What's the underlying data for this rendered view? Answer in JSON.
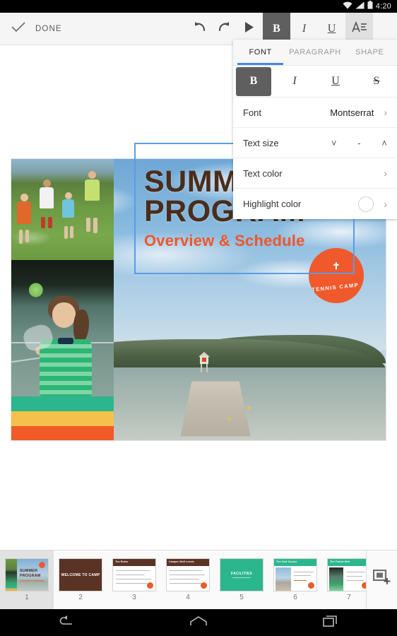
{
  "status_bar": {
    "time": "4:20",
    "icons": [
      "wifi-icon",
      "signal-icon",
      "battery-icon"
    ]
  },
  "toolbar": {
    "done_label": "DONE",
    "check_icon": "check-icon",
    "undo_icon": "undo-icon",
    "redo_icon": "redo-icon",
    "present_icon": "play-icon",
    "bold_label": "B",
    "italic_label": "I",
    "underline_label": "U",
    "text_format_label": "A",
    "overflow_icon": "overflow-menu-icon",
    "bold_active": true,
    "text_format_active": true
  },
  "font_panel": {
    "tabs": [
      {
        "label": "FONT",
        "active": true
      },
      {
        "label": "PARAGRAPH",
        "active": false
      },
      {
        "label": "SHAPE",
        "active": false
      }
    ],
    "format_buttons": [
      {
        "name": "bold",
        "label": "B",
        "selected": true
      },
      {
        "name": "italic",
        "label": "I",
        "selected": false
      },
      {
        "name": "underline",
        "label": "U",
        "selected": false
      },
      {
        "name": "strikethrough",
        "label": "S",
        "selected": false
      }
    ],
    "rows": {
      "font": {
        "label": "Font",
        "value": "Montserrat",
        "chevron": "›"
      },
      "text_size": {
        "label": "Text size",
        "value": "-",
        "decrease_icon": "chevron-down-icon",
        "increase_icon": "chevron-up-icon"
      },
      "text_color": {
        "label": "Text color",
        "chevron": "›"
      },
      "highlight_color": {
        "label": "Highlight color",
        "swatch_color": "#ffffff",
        "chevron": "›"
      }
    },
    "accent_color": "#4285f4"
  },
  "slide": {
    "title_line1": "SUMMER",
    "title_line2": "PROGRAM",
    "subtitle": "Overview & Schedule",
    "badge_text": "TENNIS CAMP",
    "badge_icon": "tennis-racket-icon",
    "badge_color": "#f0592b",
    "title_color": "#4b2c1a",
    "subtitle_color": "#f0562b",
    "selection_color": "#5b9be8",
    "accent_bars": [
      "#2bb68e",
      "#f5c14b",
      "#f15a29"
    ]
  },
  "filmstrip": {
    "add_slide_icon": "add-slide-icon",
    "slides": [
      {
        "number": "1",
        "selected": true,
        "type": "title",
        "title1": "SUMMER",
        "title2": "PROGRAM",
        "subtitle": "Overview & Schedule"
      },
      {
        "number": "2",
        "selected": false,
        "type": "section",
        "heading": "WELCOME TO CAMP"
      },
      {
        "number": "3",
        "selected": false,
        "type": "bullets",
        "heading": "The Rules",
        "bullets": 4
      },
      {
        "number": "4",
        "selected": false,
        "type": "bullets",
        "heading": "Camper Skill Levels",
        "bullets": 4
      },
      {
        "number": "5",
        "selected": false,
        "type": "section",
        "heading": "FACILITIES"
      },
      {
        "number": "6",
        "selected": false,
        "type": "photo-text",
        "heading": "The Golf Course"
      },
      {
        "number": "7",
        "selected": false,
        "type": "photo-text",
        "heading": "The Tennis Hall"
      }
    ]
  },
  "nav_bar": {
    "back_icon": "back-icon",
    "home_icon": "home-icon",
    "recents_icon": "recents-icon"
  }
}
